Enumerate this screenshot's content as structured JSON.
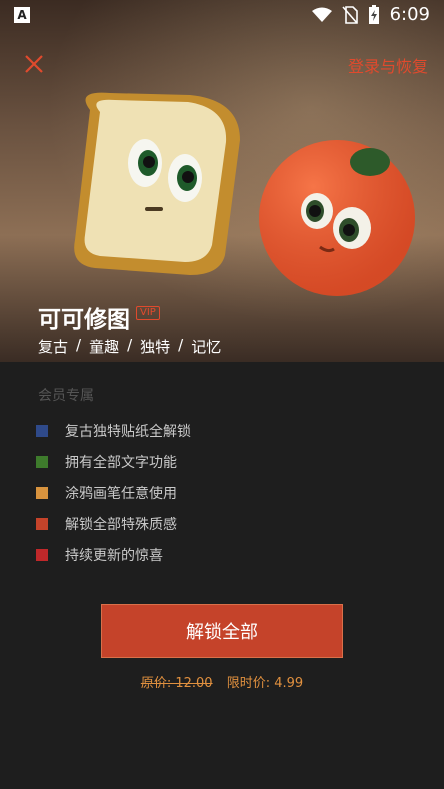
{
  "status_bar": {
    "time": "6:09",
    "left_icon": "A"
  },
  "header": {
    "close_icon": "close-icon",
    "restore_link": "登录与恢复"
  },
  "hero": {
    "title": "可可修图",
    "badge": "VIP",
    "tags": [
      "复古",
      "童趣",
      "独特",
      "记忆"
    ],
    "separator": "/"
  },
  "section": {
    "title": "会员专属"
  },
  "features": [
    {
      "label": "复古独特贴纸全解锁",
      "color": "#2f4a8a"
    },
    {
      "label": "拥有全部文字功能",
      "color": "#3e7b2c"
    },
    {
      "label": "涂鸦画笔任意使用",
      "color": "#d8933e"
    },
    {
      "label": "解锁全部特殊质感",
      "color": "#c5432a"
    },
    {
      "label": "持续更新的惊喜",
      "color": "#c0282a"
    }
  ],
  "cta": {
    "label": "解锁全部"
  },
  "pricing": {
    "original": "原价: 12.00",
    "limited": "限时价: 4.99"
  },
  "colors": {
    "accent": "#e04a2d",
    "button": "#c5432a",
    "price": "#e0903f"
  }
}
